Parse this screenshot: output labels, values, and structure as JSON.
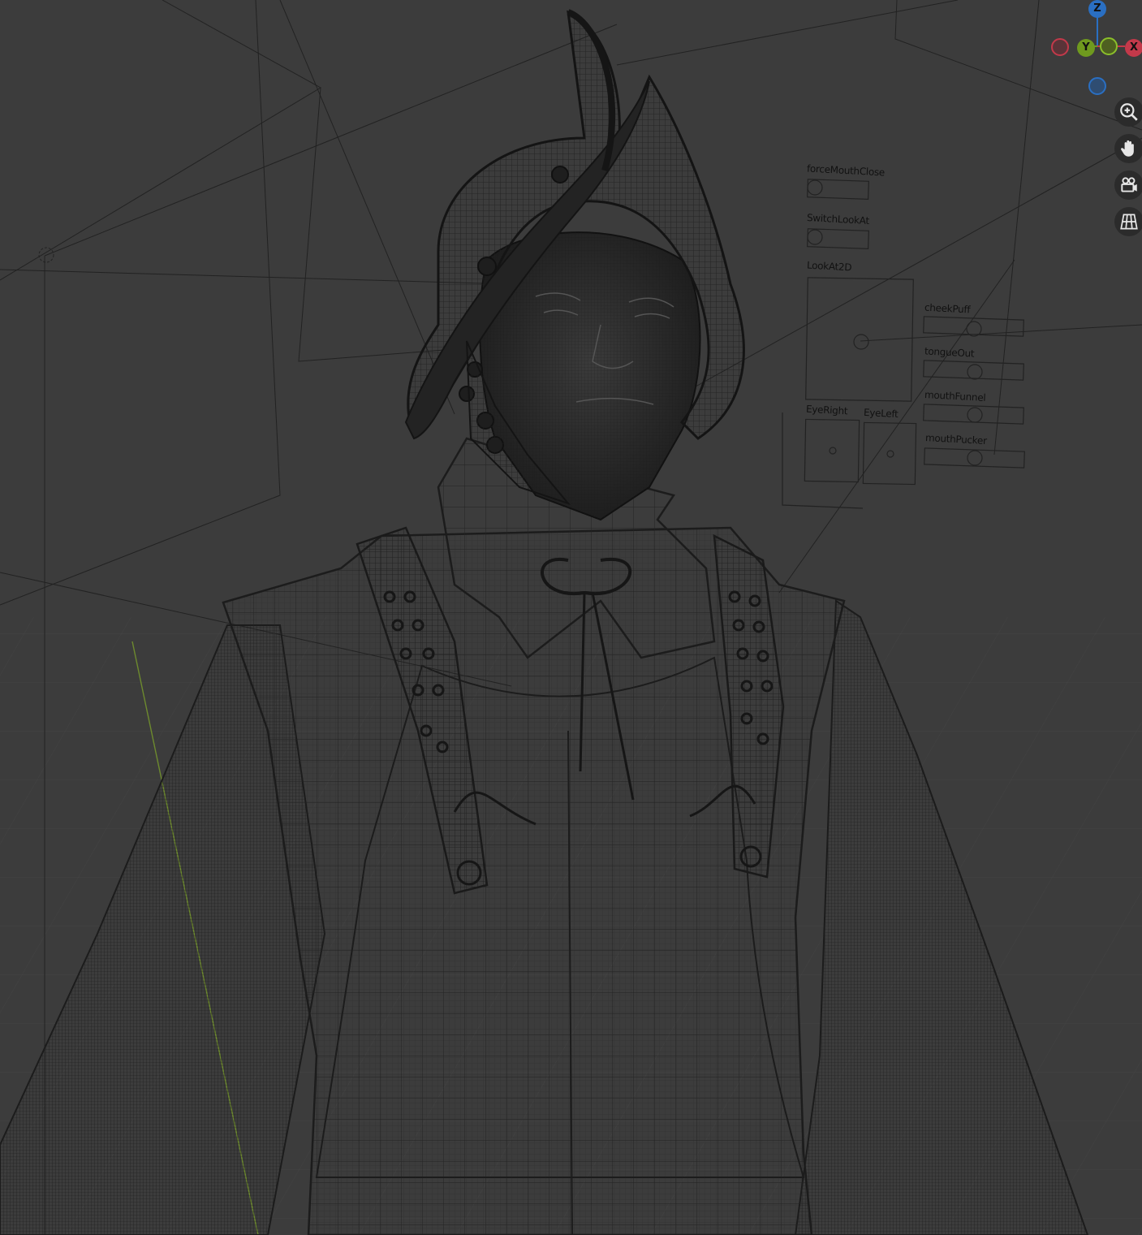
{
  "app": "Blender 3D Viewport",
  "viewport": {
    "shading": "wireframe",
    "background": "#3c3c3c"
  },
  "face_rig": {
    "labels": {
      "force_mouth_close": "forceMouthClose",
      "switch_look_at": "SwitchLookAt",
      "look_at_2d": "LookAt2D",
      "cheek_puff": "cheekPuff",
      "tongue_out": "tongueOut",
      "mouth_funnel": "mouthFunnel",
      "mouth_pucker": "mouthPucker",
      "eye_right": "EyeRight",
      "eye_left": "EyeLeft"
    }
  },
  "gizmo": {
    "z": "Z",
    "y": "Y",
    "x": "X",
    "colors": {
      "x": "#c3394a",
      "y": "#6f9a1e",
      "z": "#2a6fc2"
    }
  },
  "nav": {
    "zoom": "zoom-icon",
    "pan": "hand-icon",
    "camera": "camera-icon",
    "ortho": "grid-icon"
  }
}
